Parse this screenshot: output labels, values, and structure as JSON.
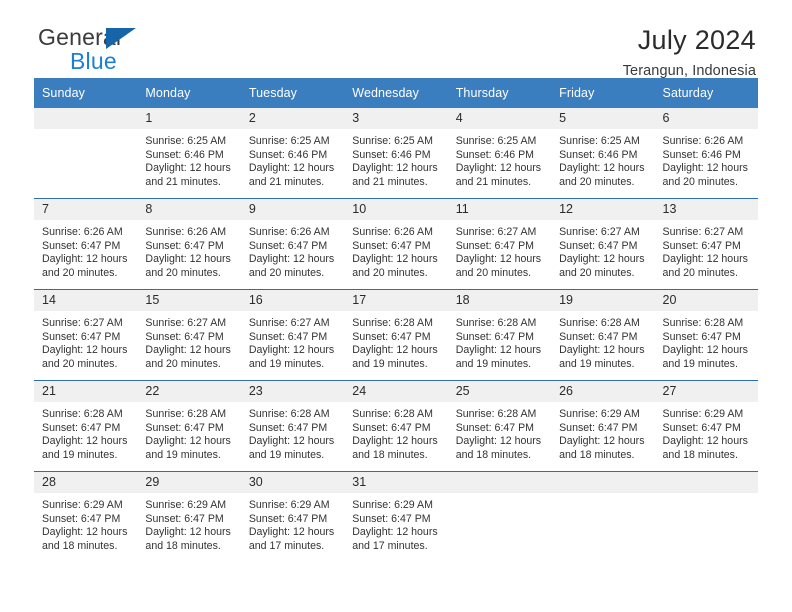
{
  "brand": {
    "name_top": "General",
    "name_bottom": "Blue",
    "triangle_color": "#1565a8",
    "blue_color": "#1c7fd4"
  },
  "header": {
    "title": "July 2024",
    "subtitle": "Terangun, Indonesia",
    "header_bg": "#3a7ec0",
    "daynum_bg": "#f0f0f0"
  },
  "weekdays": [
    "Sunday",
    "Monday",
    "Tuesday",
    "Wednesday",
    "Thursday",
    "Friday",
    "Saturday"
  ],
  "labels": {
    "sunrise_prefix": "Sunrise:",
    "sunset_prefix": "Sunset:",
    "daylight_prefix": "Daylight:"
  },
  "weeks": [
    [
      {
        "day": "",
        "lines": []
      },
      {
        "day": "1",
        "lines": [
          "Sunrise: 6:25 AM",
          "Sunset: 6:46 PM",
          "Daylight: 12 hours",
          "and 21 minutes."
        ]
      },
      {
        "day": "2",
        "lines": [
          "Sunrise: 6:25 AM",
          "Sunset: 6:46 PM",
          "Daylight: 12 hours",
          "and 21 minutes."
        ]
      },
      {
        "day": "3",
        "lines": [
          "Sunrise: 6:25 AM",
          "Sunset: 6:46 PM",
          "Daylight: 12 hours",
          "and 21 minutes."
        ]
      },
      {
        "day": "4",
        "lines": [
          "Sunrise: 6:25 AM",
          "Sunset: 6:46 PM",
          "Daylight: 12 hours",
          "and 21 minutes."
        ]
      },
      {
        "day": "5",
        "lines": [
          "Sunrise: 6:25 AM",
          "Sunset: 6:46 PM",
          "Daylight: 12 hours",
          "and 20 minutes."
        ]
      },
      {
        "day": "6",
        "lines": [
          "Sunrise: 6:26 AM",
          "Sunset: 6:46 PM",
          "Daylight: 12 hours",
          "and 20 minutes."
        ]
      }
    ],
    [
      {
        "day": "7",
        "lines": [
          "Sunrise: 6:26 AM",
          "Sunset: 6:47 PM",
          "Daylight: 12 hours",
          "and 20 minutes."
        ]
      },
      {
        "day": "8",
        "lines": [
          "Sunrise: 6:26 AM",
          "Sunset: 6:47 PM",
          "Daylight: 12 hours",
          "and 20 minutes."
        ]
      },
      {
        "day": "9",
        "lines": [
          "Sunrise: 6:26 AM",
          "Sunset: 6:47 PM",
          "Daylight: 12 hours",
          "and 20 minutes."
        ]
      },
      {
        "day": "10",
        "lines": [
          "Sunrise: 6:26 AM",
          "Sunset: 6:47 PM",
          "Daylight: 12 hours",
          "and 20 minutes."
        ]
      },
      {
        "day": "11",
        "lines": [
          "Sunrise: 6:27 AM",
          "Sunset: 6:47 PM",
          "Daylight: 12 hours",
          "and 20 minutes."
        ]
      },
      {
        "day": "12",
        "lines": [
          "Sunrise: 6:27 AM",
          "Sunset: 6:47 PM",
          "Daylight: 12 hours",
          "and 20 minutes."
        ]
      },
      {
        "day": "13",
        "lines": [
          "Sunrise: 6:27 AM",
          "Sunset: 6:47 PM",
          "Daylight: 12 hours",
          "and 20 minutes."
        ]
      }
    ],
    [
      {
        "day": "14",
        "lines": [
          "Sunrise: 6:27 AM",
          "Sunset: 6:47 PM",
          "Daylight: 12 hours",
          "and 20 minutes."
        ]
      },
      {
        "day": "15",
        "lines": [
          "Sunrise: 6:27 AM",
          "Sunset: 6:47 PM",
          "Daylight: 12 hours",
          "and 20 minutes."
        ]
      },
      {
        "day": "16",
        "lines": [
          "Sunrise: 6:27 AM",
          "Sunset: 6:47 PM",
          "Daylight: 12 hours",
          "and 19 minutes."
        ]
      },
      {
        "day": "17",
        "lines": [
          "Sunrise: 6:28 AM",
          "Sunset: 6:47 PM",
          "Daylight: 12 hours",
          "and 19 minutes."
        ]
      },
      {
        "day": "18",
        "lines": [
          "Sunrise: 6:28 AM",
          "Sunset: 6:47 PM",
          "Daylight: 12 hours",
          "and 19 minutes."
        ]
      },
      {
        "day": "19",
        "lines": [
          "Sunrise: 6:28 AM",
          "Sunset: 6:47 PM",
          "Daylight: 12 hours",
          "and 19 minutes."
        ]
      },
      {
        "day": "20",
        "lines": [
          "Sunrise: 6:28 AM",
          "Sunset: 6:47 PM",
          "Daylight: 12 hours",
          "and 19 minutes."
        ]
      }
    ],
    [
      {
        "day": "21",
        "lines": [
          "Sunrise: 6:28 AM",
          "Sunset: 6:47 PM",
          "Daylight: 12 hours",
          "and 19 minutes."
        ]
      },
      {
        "day": "22",
        "lines": [
          "Sunrise: 6:28 AM",
          "Sunset: 6:47 PM",
          "Daylight: 12 hours",
          "and 19 minutes."
        ]
      },
      {
        "day": "23",
        "lines": [
          "Sunrise: 6:28 AM",
          "Sunset: 6:47 PM",
          "Daylight: 12 hours",
          "and 19 minutes."
        ]
      },
      {
        "day": "24",
        "lines": [
          "Sunrise: 6:28 AM",
          "Sunset: 6:47 PM",
          "Daylight: 12 hours",
          "and 18 minutes."
        ]
      },
      {
        "day": "25",
        "lines": [
          "Sunrise: 6:28 AM",
          "Sunset: 6:47 PM",
          "Daylight: 12 hours",
          "and 18 minutes."
        ]
      },
      {
        "day": "26",
        "lines": [
          "Sunrise: 6:29 AM",
          "Sunset: 6:47 PM",
          "Daylight: 12 hours",
          "and 18 minutes."
        ]
      },
      {
        "day": "27",
        "lines": [
          "Sunrise: 6:29 AM",
          "Sunset: 6:47 PM",
          "Daylight: 12 hours",
          "and 18 minutes."
        ]
      }
    ],
    [
      {
        "day": "28",
        "lines": [
          "Sunrise: 6:29 AM",
          "Sunset: 6:47 PM",
          "Daylight: 12 hours",
          "and 18 minutes."
        ]
      },
      {
        "day": "29",
        "lines": [
          "Sunrise: 6:29 AM",
          "Sunset: 6:47 PM",
          "Daylight: 12 hours",
          "and 18 minutes."
        ]
      },
      {
        "day": "30",
        "lines": [
          "Sunrise: 6:29 AM",
          "Sunset: 6:47 PM",
          "Daylight: 12 hours",
          "and 17 minutes."
        ]
      },
      {
        "day": "31",
        "lines": [
          "Sunrise: 6:29 AM",
          "Sunset: 6:47 PM",
          "Daylight: 12 hours",
          "and 17 minutes."
        ]
      },
      {
        "day": "",
        "lines": []
      },
      {
        "day": "",
        "lines": []
      },
      {
        "day": "",
        "lines": []
      }
    ]
  ]
}
